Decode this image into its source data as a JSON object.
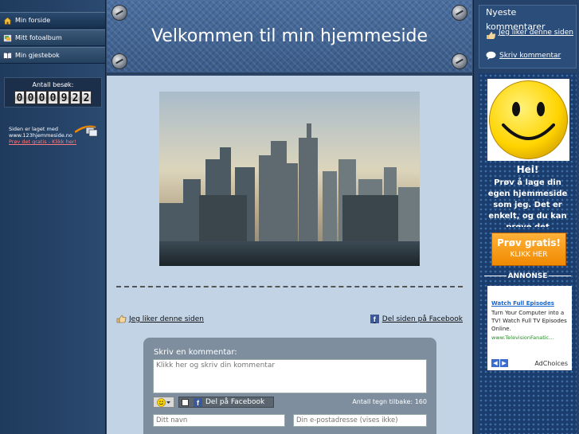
{
  "nav": {
    "items": [
      {
        "label": "Min forside",
        "icon": "home-icon"
      },
      {
        "label": "Mitt fotoalbum",
        "icon": "photo-album-icon"
      },
      {
        "label": "Min gjestebok",
        "icon": "guestbook-icon"
      }
    ]
  },
  "counter": {
    "label": "Antall besøk:",
    "digits": [
      "0",
      "0",
      "0",
      "0",
      "9",
      "2",
      "2"
    ]
  },
  "made_by": {
    "line1": "Siden er laget med",
    "line2": "www.123hjemmeside.no",
    "link": "Prøv det gratis - Klikk her!"
  },
  "header": {
    "title": "Velkommen til min hjemmeside"
  },
  "main": {
    "like_label": "Jeg liker denne siden",
    "share_label": "Del siden på Facebook"
  },
  "comment": {
    "title": "Skriv en kommentar:",
    "placeholder": "Klikk her og skriv din kommentar",
    "fb_share_label": "Del på Facebook",
    "chars_left": "Antall tegn tilbake: 160",
    "name_placeholder": "Ditt navn",
    "email_placeholder": "Din e-postadresse (vises ikke)"
  },
  "recent": {
    "title_line1": "Nyeste",
    "title_line2": "kommentarer",
    "like_label": "Jeg liker denne siden",
    "write_label": "Skriv kommentar"
  },
  "promo": {
    "greeting": "Hei!",
    "text": "Prøv å lage din egen hjemmeside som jeg. Det er enkelt, og du kan prøve det",
    "button_line1": "Prøv gratis!",
    "button_line2": "KLIKK HER"
  },
  "ad": {
    "section_label": "ANNONSE",
    "title": "Watch Full Episodes",
    "body": "Turn Your Computer into a TV! Watch Full TV Episodes Online.",
    "url": "www.TelevisionFanatic...",
    "adchoices": "AdChoices"
  },
  "colors": {
    "accent_orange": "#f08a00",
    "facebook_blue": "#3b5998",
    "link_red": "#ff7a7a"
  }
}
